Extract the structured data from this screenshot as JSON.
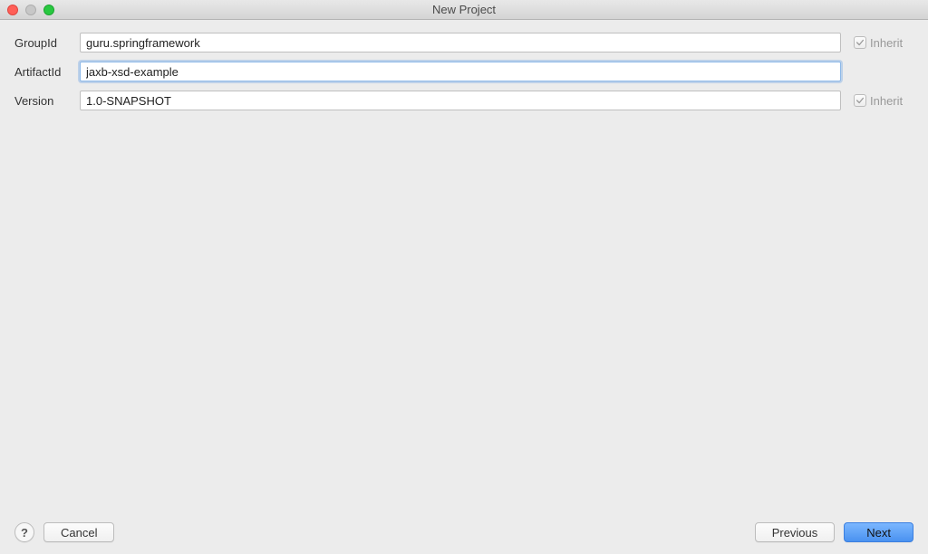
{
  "window": {
    "title": "New Project"
  },
  "form": {
    "groupIdLabel": "GroupId",
    "groupIdValue": "guru.springframework",
    "artifactIdLabel": "ArtifactId",
    "artifactIdValue": "jaxb-xsd-example",
    "versionLabel": "Version",
    "versionValue": "1.0-SNAPSHOT",
    "inheritLabel": "Inherit",
    "groupIdInheritChecked": true,
    "versionInheritChecked": true
  },
  "buttons": {
    "help": "?",
    "cancel": "Cancel",
    "previous": "Previous",
    "next": "Next"
  }
}
